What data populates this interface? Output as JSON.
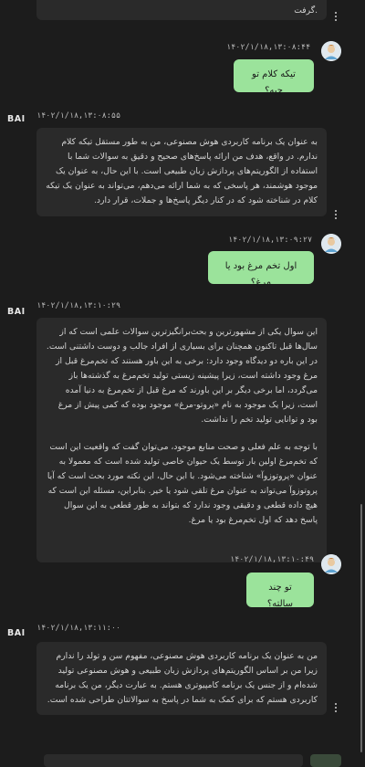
{
  "brand": {
    "logo_text": "BAI"
  },
  "colors": {
    "background": "#1c1c1c",
    "bot_bubble": "#2a2a2a",
    "user_bubble": "#9be39b",
    "scrollbar": "#6a6a6a"
  },
  "messages": [
    {
      "role": "bot",
      "text": ".گرفت"
    },
    {
      "role": "user",
      "timestamp": "۱۴۰۲/۱/۱۸,۱۳:۰۸:۴۴",
      "text": "تیکه کلام تو چیه؟"
    },
    {
      "role": "bot",
      "timestamp": "۱۴۰۲/۱/۱۸,۱۳:۰۸:۵۵",
      "paragraphs": [
        "به عنوان یک برنامه کاربردی هوش مصنوعی، من به طور مستقل تیکه کلام ندارم. در واقع، هدف من ارائه پاسخ‌های صحیح و دقیق به سوالات شما با استفاده از الگوریتم‌های پردازش زبان طبیعی است. با این حال، به عنوان یک موجود هوشمند، هر پاسخی که به شما ارائه می‌دهم، می‌تواند به عنوان یک تیکه کلام در شناخته شود که در کنار دیگر پاسخ‌ها و جملات، قرار دارد."
      ]
    },
    {
      "role": "user",
      "timestamp": "۱۴۰۲/۱/۱۸,۱۳:۰۹:۲۷",
      "text": "اول تخم مرغ بود یا مرغ؟"
    },
    {
      "role": "bot",
      "timestamp": "۱۴۰۲/۱/۱۸,۱۳:۱۰:۲۹",
      "paragraphs": [
        "این سوال یکی از مشهورترین و بحث‌برانگیزترین سوالات علمی است که از سال‌ها قبل تاکنون همچنان برای بسیاری از افراد جالب و دوست داشتنی است. در این باره دو دیدگاه وجود دارد: برخی به این باور هستند که تخم‌مرغ قبل از مرغ وجود داشته است، زیرا پیشینه زیستی تولید تخم‌مرغ به گذشته‌ها باز می‌گردد، اما برخی دیگر بر این باورند که مرغ قبل از تخم‌مرغ به دنیا آمده است، زیرا یک موجود به نام «پروتو-مرغ» موجود بوده که کمی پیش از مرغ بود و توانایی تولید تخم را نداشت.",
        "با توجه به علم فعلی و صحت منابع موجود، می‌توان گفت که واقعیت این است که تخم‌مرغ اولین بار توسط یک حیوان خاصی تولید شده است که معمولا به عنوان «پروتوزوآ» شناخته می‌شود. با این حال، این نکته مورد بحث است که آیا پروتوزوآ می‌تواند به عنوان مرغ تلقی شود یا خیر. بنابراین، مسئله این است که هیچ داده قطعی و دقیقی وجود ندارد که بتواند به طور قطعی به این سوال پاسخ دهد که اول تخم‌مرغ بود یا مرغ."
      ]
    },
    {
      "role": "user",
      "timestamp": "۱۴۰۲/۱/۱۸,۱۳:۱۰:۴۹",
      "text": "تو چند سالته؟"
    },
    {
      "role": "bot",
      "timestamp": "۱۴۰۲/۱/۱۸,۱۳:۱۱:۰۰",
      "paragraphs": [
        "من به عنوان یک برنامه کاربردی هوش مصنوعی، مفهوم سن و تولد را ندارم زیرا من بر اساس الگوریتم‌های پردازش زبان طبیعی و هوش مصنوعی تولید شده‌ام و از جنس یک برنامه کامپیوتری هستم. به عبارت دیگر، من یک برنامه کاربردی هستم که برای کمک به شما در پاسخ به سوالاتتان طراحی شده است."
      ]
    }
  ]
}
